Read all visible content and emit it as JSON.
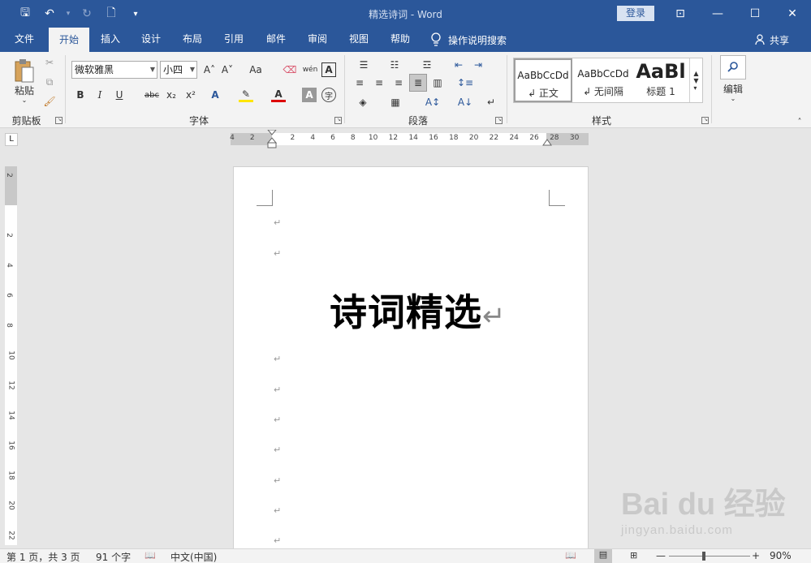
{
  "window": {
    "title": "精选诗词  -  Word",
    "login_label": "登录",
    "controls": {
      "restore_ribbon": "⊡",
      "minimize": "—",
      "maximize": "☐",
      "close": "✕"
    }
  },
  "quick_access": {
    "save": "🖫",
    "undo": "↶",
    "undo_dropdown": "▾",
    "redo": "↻",
    "new_doc": "🗋",
    "customize": "▾"
  },
  "tabs": [
    {
      "label": "文件"
    },
    {
      "label": "开始"
    },
    {
      "label": "插入"
    },
    {
      "label": "设计"
    },
    {
      "label": "布局"
    },
    {
      "label": "引用"
    },
    {
      "label": "邮件"
    },
    {
      "label": "审阅"
    },
    {
      "label": "视图"
    },
    {
      "label": "帮助"
    }
  ],
  "tell_me": {
    "label": "操作说明搜索"
  },
  "share": {
    "label": "共享"
  },
  "ribbon": {
    "clipboard": {
      "label": "剪贴板",
      "paste": "粘贴"
    },
    "font": {
      "label": "字体",
      "font_name": "微软雅黑",
      "font_size": "小四",
      "bold": "B",
      "italic": "I",
      "underline": "U",
      "strike": "abc",
      "subscript": "x₂",
      "superscript": "x²",
      "grow": "A˄",
      "shrink": "A˅",
      "change_case": "Aa",
      "phonetic": "wén",
      "border_char": "A",
      "effects": "A",
      "char_shading": "A",
      "enclose": "字"
    },
    "paragraph": {
      "label": "段落"
    },
    "styles": {
      "label": "样式",
      "items": [
        {
          "preview": "AaBbCcDd",
          "name": "↲ 正文"
        },
        {
          "preview": "AaBbCcDd",
          "name": "↲ 无间隔"
        },
        {
          "preview": "AaBl",
          "name": "标题 1"
        }
      ]
    },
    "editing": {
      "label": "编辑"
    }
  },
  "ruler": {
    "h_labels": [
      "4",
      "2",
      "",
      "2",
      "4",
      "6",
      "8",
      "10",
      "12",
      "14",
      "16",
      "18",
      "20",
      "22",
      "24",
      "26",
      "28",
      "30"
    ],
    "v_labels": [
      "2",
      "",
      "2",
      "4",
      "6",
      "8",
      "10",
      "12",
      "14",
      "16",
      "18",
      "20",
      "22"
    ],
    "corner": "L"
  },
  "document": {
    "heading": "诗词精选",
    "para_mark": "↵"
  },
  "watermark": {
    "brand": "Bai du 经验",
    "url": "jingyan.baidu.com"
  },
  "status": {
    "page": "第 1 页，共 3 页",
    "words": "91 个字",
    "language": "中文(中国)",
    "zoom_minus": "—",
    "zoom_plus": "+",
    "zoom": "90%"
  }
}
